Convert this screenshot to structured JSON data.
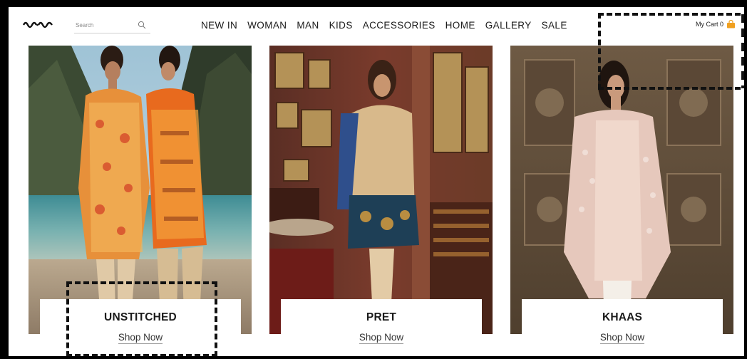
{
  "header": {
    "logo_alt": "brand-logo",
    "search": {
      "placeholder": "Search",
      "value": ""
    },
    "nav": [
      "NEW IN",
      "WOMAN",
      "MAN",
      "KIDS",
      "ACCESSORIES",
      "HOME",
      "GALLERY",
      "SALE"
    ],
    "cart_label": "My Cart 0"
  },
  "collections": [
    {
      "title": "UNSTITCHED",
      "link": "Shop Now"
    },
    {
      "title": "PRET",
      "link": "Shop Now"
    },
    {
      "title": "KHAAS",
      "link": "Shop Now"
    }
  ],
  "colors": {
    "cart_icon": "#f0a020",
    "nav_text": "#1a1a1a",
    "frame": "#000000"
  }
}
